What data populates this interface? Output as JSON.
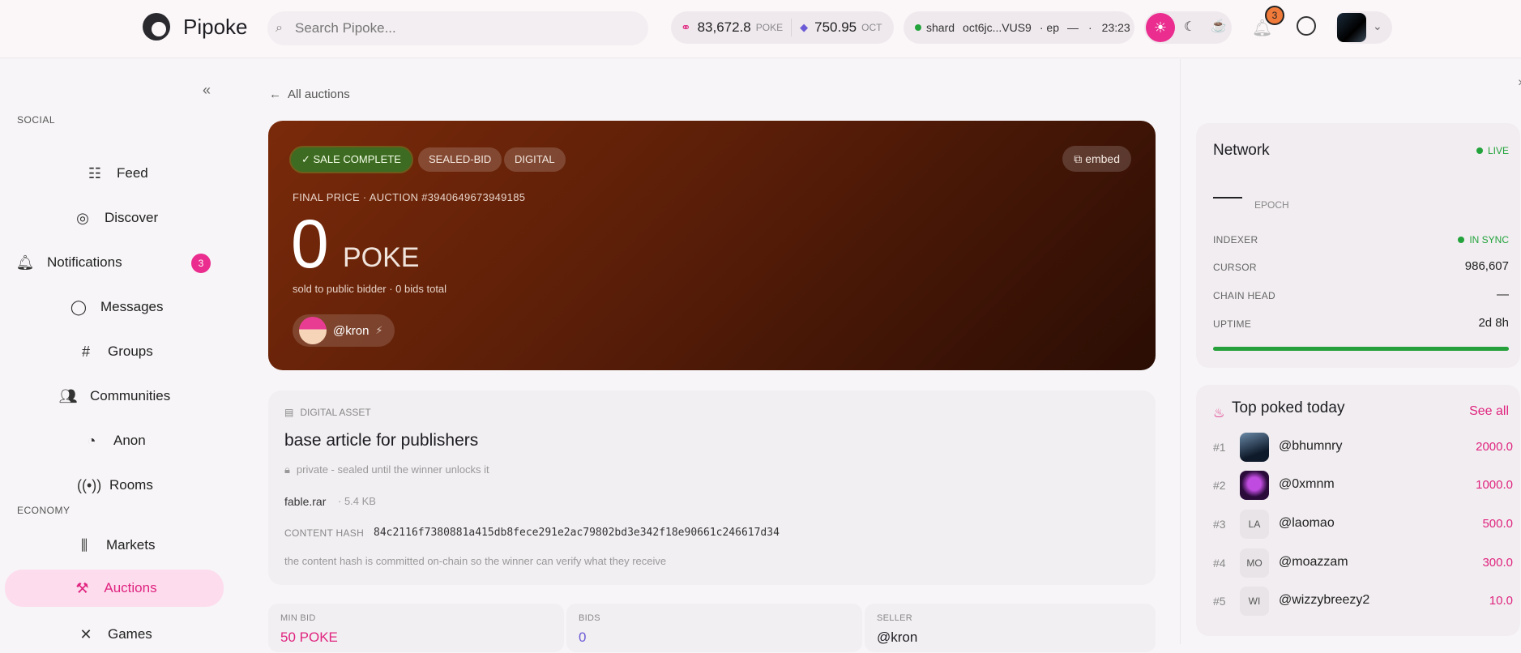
{
  "header": {
    "brand": "Pipoke",
    "search_placeholder": "Search Pipoke...",
    "balance_poke": "83,672.8",
    "balance_poke_unit": "POKE",
    "balance_oct": "750.95",
    "balance_oct_unit": "OCT",
    "shard_label": "shard",
    "shard_id": "oct6jc...VUS9",
    "ep_label": "· ep",
    "ep_value": "—",
    "sep": "·",
    "clock": "23:23",
    "notif_count": "3"
  },
  "sidebar": {
    "social_label": "SOCIAL",
    "economy_label": "ECONOMY",
    "items": {
      "feed": "Feed",
      "discover": "Discover",
      "notifications": "Notifications",
      "notifications_badge": "3",
      "messages": "Messages",
      "groups": "Groups",
      "communities": "Communities",
      "anon": "Anon",
      "rooms": "Rooms",
      "markets": "Markets",
      "auctions": "Auctions",
      "games": "Games"
    }
  },
  "main": {
    "back_label": "All auctions",
    "hero": {
      "status": "SALE COMPLETE",
      "tag_type": "SEALED-BID",
      "tag_kind": "DIGITAL",
      "embed_label": "embed",
      "final_line": "FINAL PRICE · AUCTION #3940649673949185",
      "price": "0",
      "price_unit": "POKE",
      "sold_line": "sold to public bidder · 0 bids total",
      "seller": "@kron"
    },
    "asset": {
      "label": "DIGITAL ASSET",
      "title": "base article for publishers",
      "lock_note": "private - sealed until the winner unlocks it",
      "file": "fable.rar",
      "size": "· 5.4 KB",
      "hash_label": "CONTENT HASH",
      "hash": "84c2116f7380881a415db8fece291e2ac79802bd3e342f18e90661c246617d34",
      "hash_note": "the content hash is committed on-chain so the winner can verify what they receive"
    },
    "stats": {
      "min_bid_label": "MIN BID",
      "min_bid": "50 POKE",
      "bids_label": "BIDS",
      "bids": "0",
      "seller_label": "SELLER",
      "seller": "@kron"
    }
  },
  "right_panel": {
    "network": {
      "title": "Network",
      "live": "LIVE",
      "epoch_label": "EPOCH",
      "indexer_label": "INDEXER",
      "indexer_value": "IN SYNC",
      "cursor_label": "CURSOR",
      "cursor_value": "986,607",
      "chain_head_label": "CHAIN HEAD",
      "chain_head_value": "—",
      "uptime_label": "UPTIME",
      "uptime_value": "2d 8h"
    },
    "top_poked": {
      "title": "Top poked today",
      "see_all": "See all",
      "rows": [
        {
          "rank": "#1",
          "initials": "",
          "name": "@bhumnry",
          "value": "2000.0"
        },
        {
          "rank": "#2",
          "initials": "",
          "name": "@0xmnm",
          "value": "1000.0"
        },
        {
          "rank": "#3",
          "initials": "LA",
          "name": "@laomao",
          "value": "500.0"
        },
        {
          "rank": "#4",
          "initials": "MO",
          "name": "@moazzam",
          "value": "300.0"
        },
        {
          "rank": "#5",
          "initials": "WI",
          "name": "@wizzybreezy2",
          "value": "10.0"
        }
      ]
    }
  },
  "colors": {
    "accent": "#e0247f",
    "hero_start": "#7a2a0a",
    "hero_end": "#2a0d04",
    "success": "#23a33c"
  }
}
